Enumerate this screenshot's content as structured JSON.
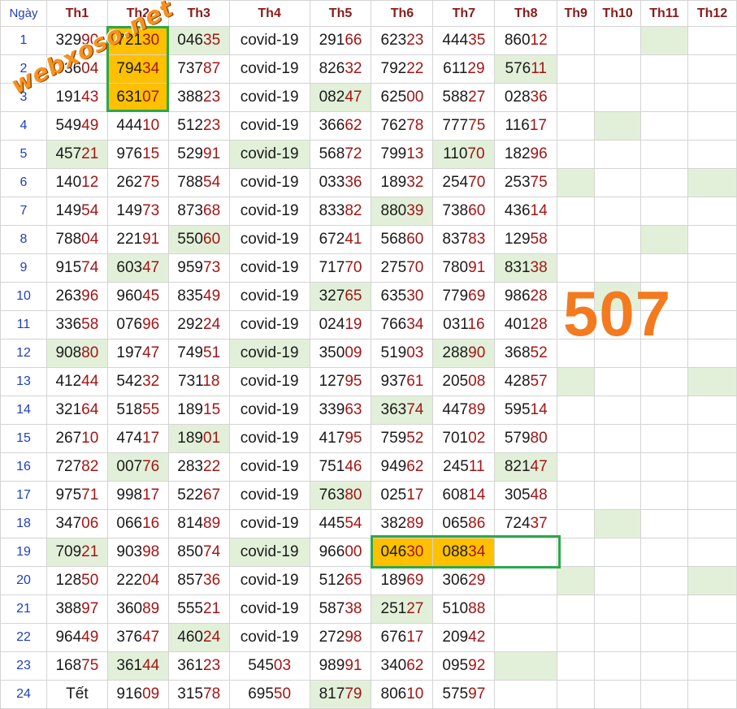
{
  "header": {
    "day_label": "Ngày",
    "months": [
      "Th1",
      "Th2",
      "Th3",
      "Th4",
      "Th5",
      "Th6",
      "Th7",
      "Th8",
      "Th9",
      "Th10",
      "Th11",
      "Th12"
    ]
  },
  "rows": [
    {
      "day": "1",
      "cells": [
        "32990",
        "72130",
        "04635",
        "covid-19",
        "29166",
        "62323",
        "44435",
        "86012",
        "",
        "",
        "",
        ""
      ]
    },
    {
      "day": "2",
      "cells": [
        "73604",
        "79434",
        "73787",
        "covid-19",
        "82632",
        "79222",
        "61129",
        "57611",
        "",
        "",
        "",
        ""
      ]
    },
    {
      "day": "3",
      "cells": [
        "19143",
        "63107",
        "38823",
        "covid-19",
        "08247",
        "62500",
        "58827",
        "02836",
        "",
        "",
        "",
        ""
      ]
    },
    {
      "day": "4",
      "cells": [
        "54949",
        "44410",
        "51223",
        "covid-19",
        "36662",
        "76278",
        "77775",
        "11617",
        "",
        "",
        "",
        ""
      ]
    },
    {
      "day": "5",
      "cells": [
        "45721",
        "97615",
        "52991",
        "covid-19",
        "56872",
        "79913",
        "11070",
        "18296",
        "",
        "",
        "",
        ""
      ]
    },
    {
      "day": "6",
      "cells": [
        "14012",
        "26275",
        "78854",
        "covid-19",
        "03336",
        "18932",
        "25470",
        "25375",
        "",
        "",
        "",
        ""
      ]
    },
    {
      "day": "7",
      "cells": [
        "14954",
        "14973",
        "87368",
        "covid-19",
        "83382",
        "88039",
        "73860",
        "43614",
        "",
        "",
        "",
        ""
      ]
    },
    {
      "day": "8",
      "cells": [
        "78804",
        "22191",
        "55060",
        "covid-19",
        "67241",
        "56860",
        "83783",
        "12958",
        "",
        "",
        "",
        ""
      ]
    },
    {
      "day": "9",
      "cells": [
        "91574",
        "60347",
        "95973",
        "covid-19",
        "71770",
        "27570",
        "78091",
        "83138",
        "",
        "",
        "",
        ""
      ]
    },
    {
      "day": "10",
      "cells": [
        "26396",
        "96045",
        "83549",
        "covid-19",
        "32765",
        "63530",
        "77969",
        "98628",
        "",
        "",
        "",
        ""
      ]
    },
    {
      "day": "11",
      "cells": [
        "33658",
        "07696",
        "29224",
        "covid-19",
        "02419",
        "76634",
        "03116",
        "40128",
        "",
        "",
        "",
        ""
      ]
    },
    {
      "day": "12",
      "cells": [
        "90880",
        "19747",
        "74951",
        "covid-19",
        "35009",
        "51903",
        "28890",
        "36852",
        "",
        "",
        "",
        ""
      ]
    },
    {
      "day": "13",
      "cells": [
        "41244",
        "54232",
        "73118",
        "covid-19",
        "12795",
        "93761",
        "20508",
        "42857",
        "",
        "",
        "",
        ""
      ]
    },
    {
      "day": "14",
      "cells": [
        "32164",
        "51855",
        "18915",
        "covid-19",
        "33963",
        "36374",
        "44789",
        "59514",
        "",
        "",
        "",
        ""
      ]
    },
    {
      "day": "15",
      "cells": [
        "26710",
        "47417",
        "18901",
        "covid-19",
        "41795",
        "75952",
        "70102",
        "57980",
        "",
        "",
        "",
        ""
      ]
    },
    {
      "day": "16",
      "cells": [
        "72782",
        "00776",
        "28322",
        "covid-19",
        "75146",
        "94962",
        "24511",
        "82147",
        "",
        "",
        "",
        ""
      ]
    },
    {
      "day": "17",
      "cells": [
        "97571",
        "99817",
        "52267",
        "covid-19",
        "76380",
        "02517",
        "60814",
        "30548",
        "",
        "",
        "",
        ""
      ]
    },
    {
      "day": "18",
      "cells": [
        "34706",
        "06616",
        "81489",
        "covid-19",
        "44554",
        "38289",
        "06586",
        "72437",
        "",
        "",
        "",
        ""
      ]
    },
    {
      "day": "19",
      "cells": [
        "70921",
        "90398",
        "85074",
        "covid-19",
        "96600",
        "04630",
        "08834",
        "",
        "",
        "",
        "",
        ""
      ]
    },
    {
      "day": "20",
      "cells": [
        "12850",
        "22204",
        "85736",
        "covid-19",
        "51265",
        "18969",
        "30629",
        "",
        "",
        "",
        "",
        ""
      ]
    },
    {
      "day": "21",
      "cells": [
        "38897",
        "36089",
        "55521",
        "covid-19",
        "58738",
        "25127",
        "51088",
        "",
        "",
        "",
        "",
        ""
      ]
    },
    {
      "day": "22",
      "cells": [
        "96449",
        "37647",
        "46024",
        "covid-19",
        "27298",
        "67617",
        "20942",
        "",
        "",
        "",
        "",
        ""
      ]
    },
    {
      "day": "23",
      "cells": [
        "16875",
        "36144",
        "36123",
        "54503",
        "98991",
        "34062",
        "09592",
        "",
        "",
        "",
        "",
        ""
      ]
    },
    {
      "day": "24",
      "cells": [
        "Tết",
        "91609",
        "31578",
        "69550",
        "81779",
        "80610",
        "57597",
        "",
        "",
        "",
        "",
        ""
      ]
    }
  ],
  "highlights": {
    "green_cells": [
      [
        1,
        2
      ],
      [
        1,
        10
      ],
      [
        2,
        7
      ],
      [
        3,
        4
      ],
      [
        4,
        9
      ],
      [
        5,
        0
      ],
      [
        5,
        3
      ],
      [
        5,
        6
      ],
      [
        6,
        8
      ],
      [
        6,
        11
      ],
      [
        7,
        5
      ],
      [
        8,
        2
      ],
      [
        8,
        10
      ],
      [
        9,
        1
      ],
      [
        9,
        7
      ],
      [
        10,
        4
      ],
      [
        10,
        9
      ],
      [
        12,
        0
      ],
      [
        12,
        3
      ],
      [
        12,
        6
      ],
      [
        13,
        8
      ],
      [
        13,
        11
      ],
      [
        14,
        5
      ],
      [
        15,
        2
      ],
      [
        16,
        1
      ],
      [
        16,
        7
      ],
      [
        17,
        4
      ],
      [
        18,
        9
      ],
      [
        19,
        0
      ],
      [
        19,
        3
      ],
      [
        20,
        8
      ],
      [
        20,
        11
      ],
      [
        21,
        5
      ],
      [
        22,
        2
      ],
      [
        23,
        1
      ],
      [
        23,
        7
      ],
      [
        24,
        4
      ]
    ],
    "orange_cells": [
      [
        1,
        1
      ],
      [
        2,
        1
      ],
      [
        3,
        1
      ],
      [
        19,
        5
      ],
      [
        19,
        6
      ]
    ],
    "orange_accent": "#ffc000",
    "green_accent": "#e2f0d9",
    "marker_color": "#2ca84a"
  },
  "watermark": "webxoso.net",
  "overlay_number": "507"
}
